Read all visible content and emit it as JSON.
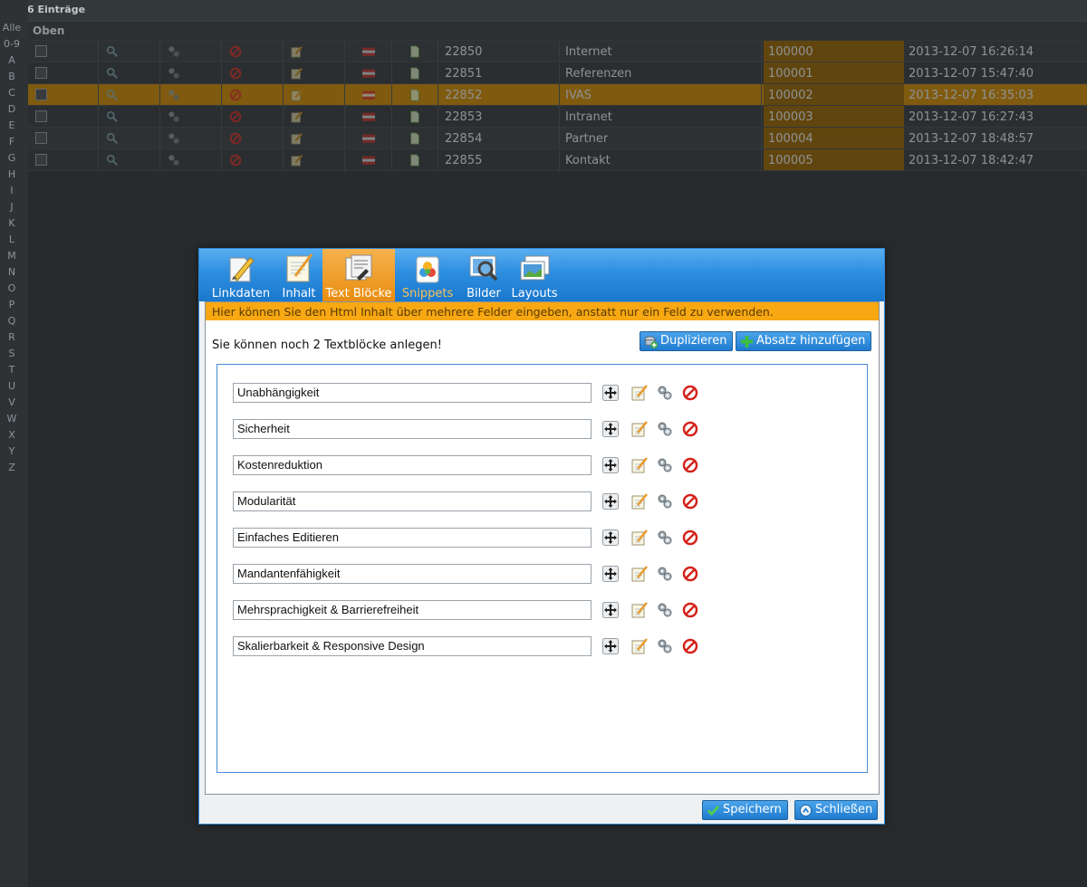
{
  "list": {
    "count_label": "6 Einträge",
    "section_label": "Oben",
    "alphabet": [
      "Alle",
      "0-9",
      "A",
      "B",
      "C",
      "D",
      "E",
      "F",
      "G",
      "H",
      "I",
      "J",
      "K",
      "L",
      "M",
      "N",
      "O",
      "P",
      "Q",
      "R",
      "S",
      "T",
      "U",
      "V",
      "W",
      "X",
      "Y",
      "Z"
    ],
    "rows": [
      {
        "id": "22850",
        "name": "Internet",
        "number": "100000",
        "date": "2013-12-07 16:26:14"
      },
      {
        "id": "22851",
        "name": "Referenzen",
        "number": "100001",
        "date": "2013-12-07 15:47:40"
      },
      {
        "id": "22852",
        "name": "IVAS",
        "number": "100002",
        "date": "2013-12-07 16:35:03"
      },
      {
        "id": "22853",
        "name": "Intranet",
        "number": "100003",
        "date": "2013-12-07 16:27:43"
      },
      {
        "id": "22854",
        "name": "Partner",
        "number": "100004",
        "date": "2013-12-07 18:48:57"
      },
      {
        "id": "22855",
        "name": "Kontakt",
        "number": "100005",
        "date": "2013-12-07 18:42:47"
      }
    ]
  },
  "dialog": {
    "tabs": [
      {
        "label": "Linkdaten",
        "icon": "pencil-doc-icon"
      },
      {
        "label": "Inhalt",
        "icon": "notepad-icon"
      },
      {
        "label": "Text Blöcke",
        "icon": "text-blocks-icon"
      },
      {
        "label": "Snippets",
        "icon": "snippets-icon"
      },
      {
        "label": "Bilder",
        "icon": "images-search-icon"
      },
      {
        "label": "Layouts",
        "icon": "layouts-icon"
      }
    ],
    "hint": "Hier können Sie den Html Inhalt über mehrere Felder eingeben, anstatt nur ein Feld zu verwenden.",
    "remaining": "Sie können noch 2 Textblöcke anlegen!",
    "duplicate_label": "Duplizieren",
    "add_paragraph_label": "Absatz hinzufügen",
    "blocks": [
      "Unabhängigkeit",
      "Sicherheit",
      "Kostenreduktion",
      "Modularität",
      "Einfaches Editieren",
      "Mandantenfähigkeit",
      "Mehrsprachigkeit & Barrierefreiheit",
      "Skalierbarkeit & Responsive Design"
    ],
    "save_label": "Speichern",
    "close_label": "Schließen"
  },
  "colors": {
    "accent": "#2d8ee0",
    "active_tab": "#e98d0f",
    "hint_bg": "#f7a813"
  }
}
